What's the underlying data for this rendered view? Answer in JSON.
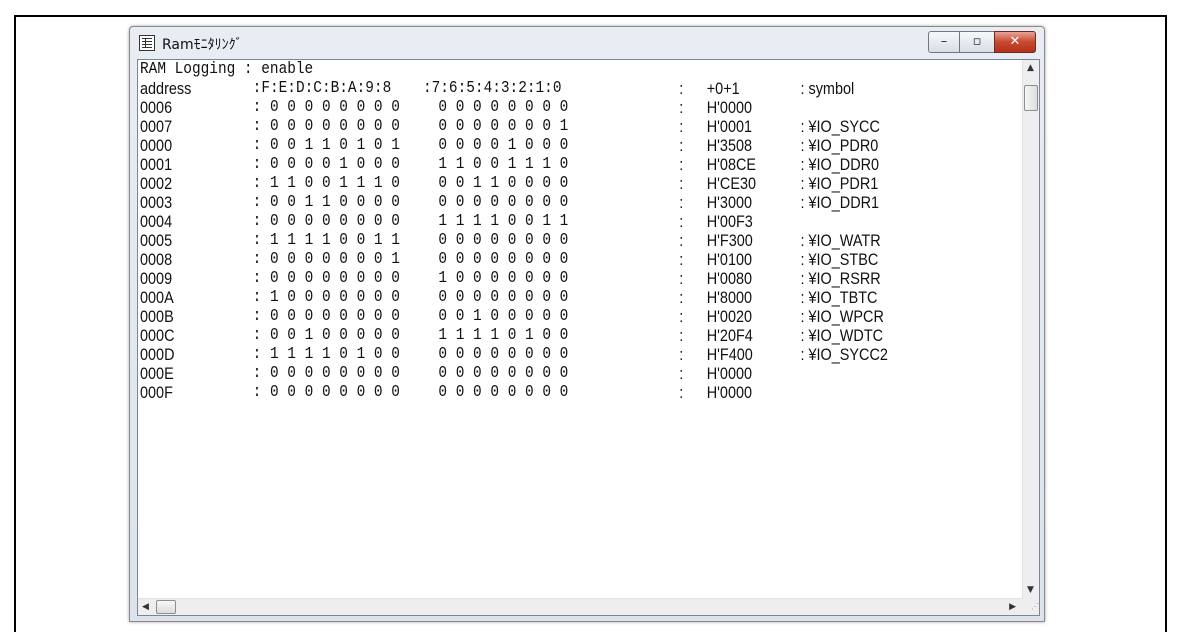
{
  "window": {
    "title": "Ramﾓﾆﾀﾘﾝｸﾞ",
    "controls": {
      "minimize": "–",
      "maximize": "▫",
      "close": "✕"
    }
  },
  "log": {
    "status_line": "RAM Logging : enable",
    "header": {
      "address": "address",
      "bits_high": ":F:E:D:C:B:A:9:8",
      "bits_low": ":7:6:5:4:3:2:1:0",
      "sep": ":",
      "value": "+0+1",
      "symbol": ": symbol"
    },
    "rows": [
      {
        "address": "0006",
        "bits_high": ": 0 0 0 0 0 0 0 0",
        "bits_low": "0 0 0 0 0 0 0 0",
        "sep": ":",
        "value": "H'0000",
        "symbol": ""
      },
      {
        "address": "0007",
        "bits_high": ": 0 0 0 0 0 0 0 0",
        "bits_low": "0 0 0 0 0 0 0 1",
        "sep": ":",
        "value": "H'0001",
        "symbol": ": ¥IO_SYCC"
      },
      {
        "address": "0000",
        "bits_high": ": 0 0 1 1 0 1 0 1",
        "bits_low": "0 0 0 0 1 0 0 0",
        "sep": ":",
        "value": "H'3508",
        "symbol": ": ¥IO_PDR0"
      },
      {
        "address": "0001",
        "bits_high": ": 0 0 0 0 1 0 0 0",
        "bits_low": "1 1 0 0 1 1 1 0",
        "sep": ":",
        "value": "H'08CE",
        "symbol": ": ¥IO_DDR0"
      },
      {
        "address": "0002",
        "bits_high": ": 1 1 0 0 1 1 1 0",
        "bits_low": "0 0 1 1 0 0 0 0",
        "sep": ":",
        "value": "H'CE30",
        "symbol": ": ¥IO_PDR1"
      },
      {
        "address": "0003",
        "bits_high": ": 0 0 1 1 0 0 0 0",
        "bits_low": "0 0 0 0 0 0 0 0",
        "sep": ":",
        "value": "H'3000",
        "symbol": ": ¥IO_DDR1"
      },
      {
        "address": "0004",
        "bits_high": ": 0 0 0 0 0 0 0 0",
        "bits_low": "1 1 1 1 0 0 1 1",
        "sep": ":",
        "value": "H'00F3",
        "symbol": ""
      },
      {
        "address": "0005",
        "bits_high": ": 1 1 1 1 0 0 1 1",
        "bits_low": "0 0 0 0 0 0 0 0",
        "sep": ":",
        "value": "H'F300",
        "symbol": ": ¥IO_WATR"
      },
      {
        "address": "0008",
        "bits_high": ": 0 0 0 0 0 0 0 1",
        "bits_low": "0 0 0 0 0 0 0 0",
        "sep": ":",
        "value": "H'0100",
        "symbol": ": ¥IO_STBC"
      },
      {
        "address": "0009",
        "bits_high": ": 0 0 0 0 0 0 0 0",
        "bits_low": "1 0 0 0 0 0 0 0",
        "sep": ":",
        "value": "H'0080",
        "symbol": ": ¥IO_RSRR"
      },
      {
        "address": "000A",
        "bits_high": ": 1 0 0 0 0 0 0 0",
        "bits_low": "0 0 0 0 0 0 0 0",
        "sep": ":",
        "value": "H'8000",
        "symbol": ": ¥IO_TBTC"
      },
      {
        "address": "000B",
        "bits_high": ": 0 0 0 0 0 0 0 0",
        "bits_low": "0 0 1 0 0 0 0 0",
        "sep": ":",
        "value": "H'0020",
        "symbol": ": ¥IO_WPCR"
      },
      {
        "address": "000C",
        "bits_high": ": 0 0 1 0 0 0 0 0",
        "bits_low": "1 1 1 1 0 1 0 0",
        "sep": ":",
        "value": "H'20F4",
        "symbol": ": ¥IO_WDTC"
      },
      {
        "address": "000D",
        "bits_high": ": 1 1 1 1 0 1 0 0",
        "bits_low": "0 0 0 0 0 0 0 0",
        "sep": ":",
        "value": "H'F400",
        "symbol": ": ¥IO_SYCC2"
      },
      {
        "address": "000E",
        "bits_high": ": 0 0 0 0 0 0 0 0",
        "bits_low": "0 0 0 0 0 0 0 0",
        "sep": ":",
        "value": "H'0000",
        "symbol": ""
      },
      {
        "address": "000F",
        "bits_high": ": 0 0 0 0 0 0 0 0",
        "bits_low": "0 0 0 0 0 0 0 0",
        "sep": ":",
        "value": "H'0000",
        "symbol": ""
      }
    ]
  },
  "scrollbars": {
    "up_arrow": "▲",
    "down_arrow": "▼",
    "left_arrow": "◀",
    "right_arrow": "▶",
    "grip": "⋰"
  }
}
